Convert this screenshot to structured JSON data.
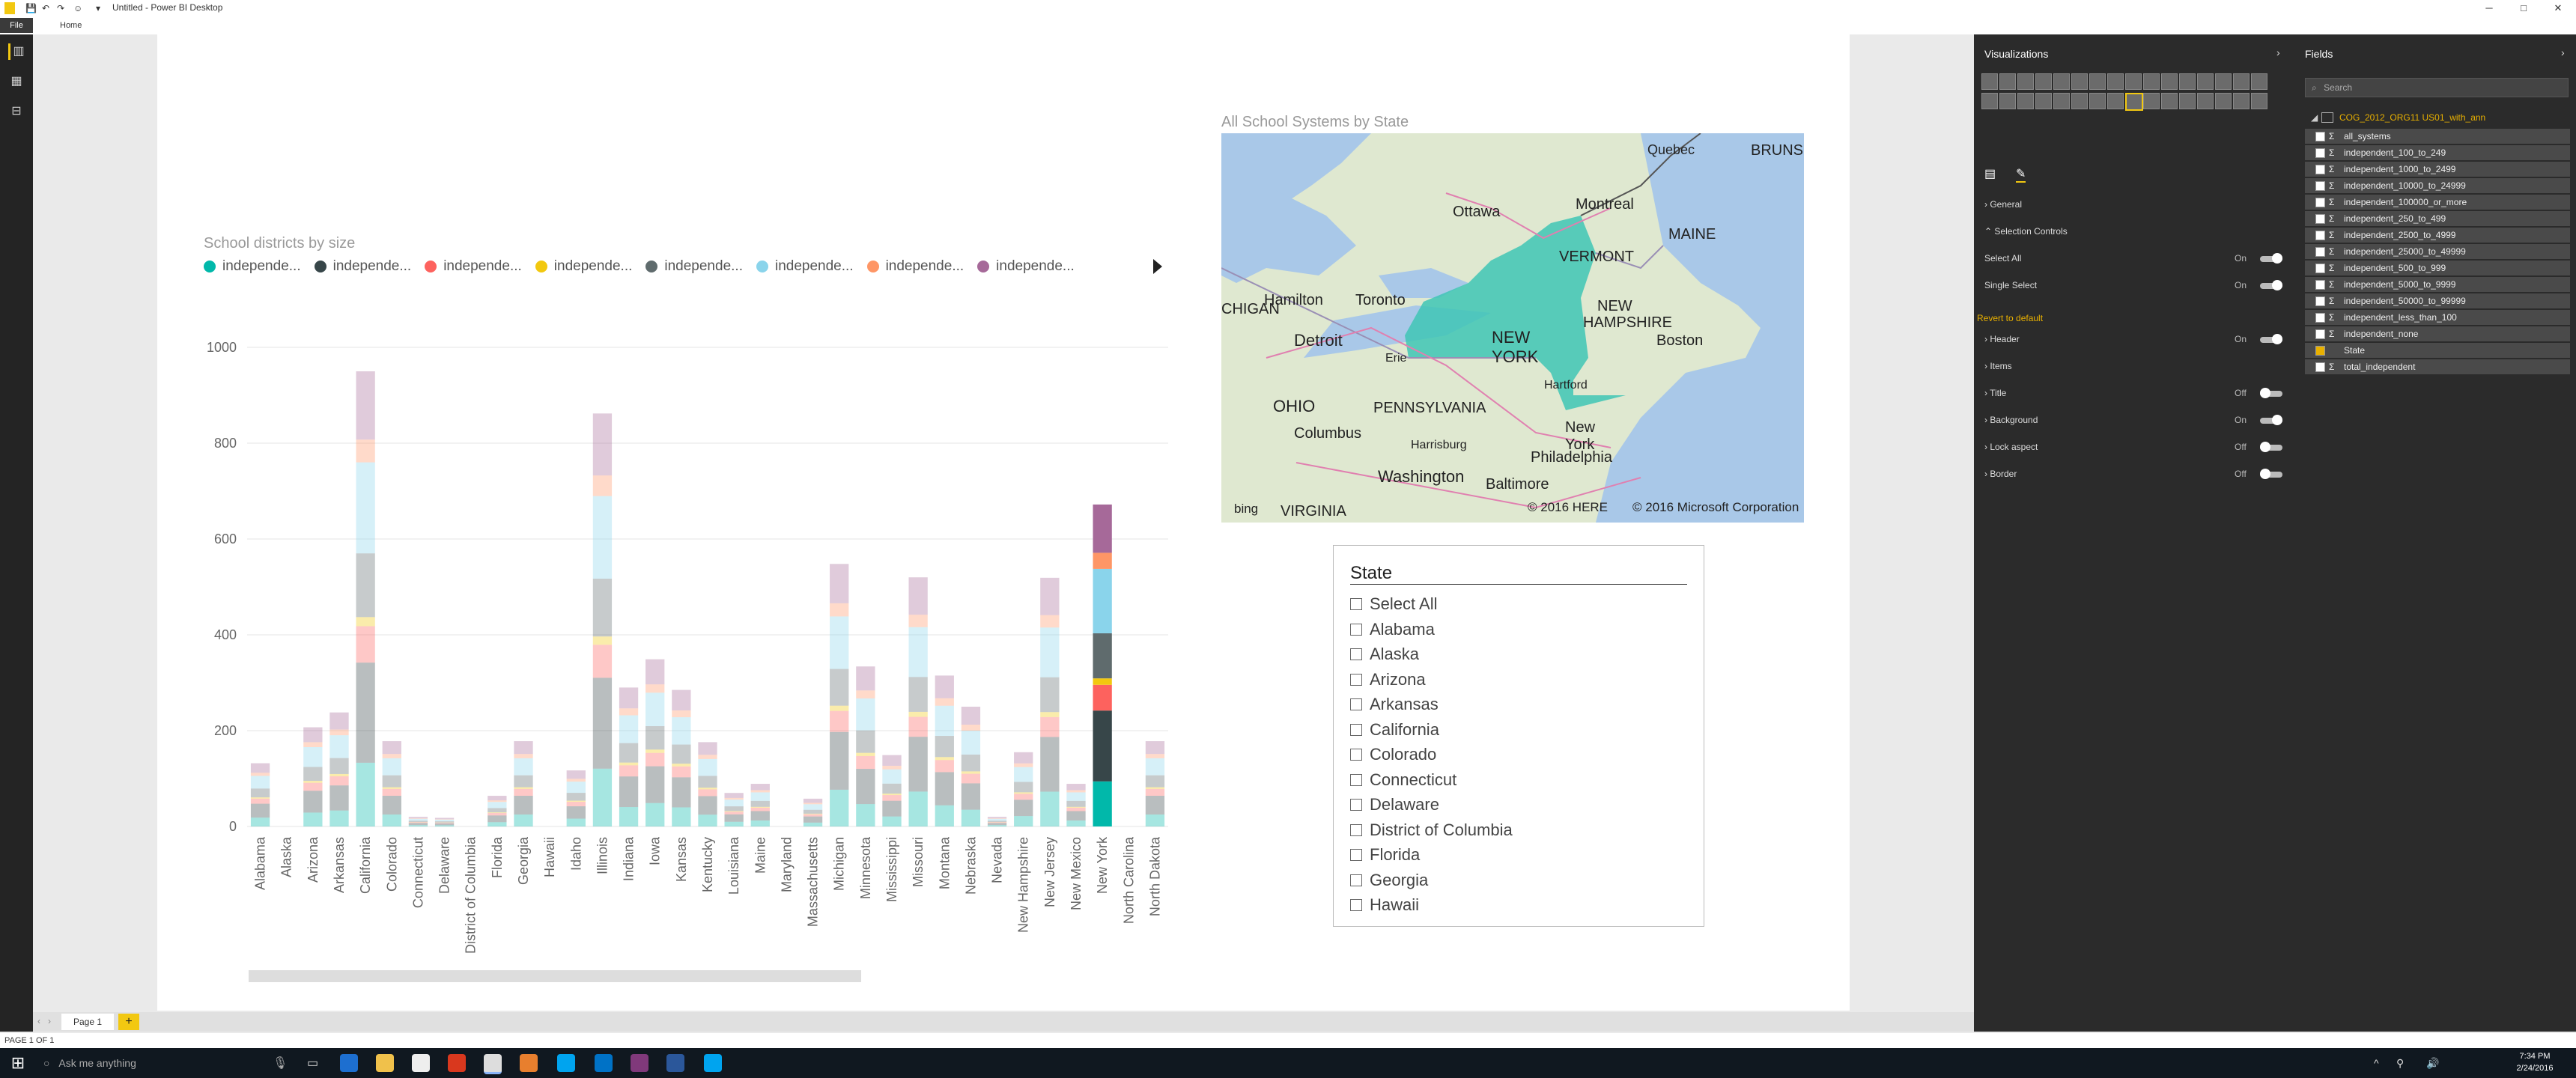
{
  "window": {
    "title": "Untitled - Power BI Desktop",
    "controls": {
      "minimize": "─",
      "maximize": "□",
      "close": "✕"
    }
  },
  "ribbon": {
    "file": "File",
    "home": "Home"
  },
  "bar_chart_visual": {
    "title": "School districts by size",
    "legend": [
      {
        "label": "independe...",
        "color": "#01b8aa"
      },
      {
        "label": "independe...",
        "color": "#374649"
      },
      {
        "label": "independe...",
        "color": "#fd625e"
      },
      {
        "label": "independe...",
        "color": "#f2c80f"
      },
      {
        "label": "independe...",
        "color": "#5f6b6d"
      },
      {
        "label": "independe...",
        "color": "#8ad4eb"
      },
      {
        "label": "independe...",
        "color": "#fe9666"
      },
      {
        "label": "independe...",
        "color": "#a66999"
      }
    ]
  },
  "chart_data": {
    "type": "bar",
    "stacked": true,
    "title": "School districts by size",
    "ylim": [
      0,
      1000
    ],
    "yticks": [
      0,
      200,
      400,
      600,
      800,
      1000
    ],
    "grid": true,
    "categories": [
      "Alabama",
      "Alaska",
      "Arizona",
      "Arkansas",
      "California",
      "Colorado",
      "Connecticut",
      "Delaware",
      "District of Columbia",
      "Florida",
      "Georgia",
      "Hawaii",
      "Idaho",
      "Illinois",
      "Indiana",
      "Iowa",
      "Kansas",
      "Kentucky",
      "Louisiana",
      "Maine",
      "Maryland",
      "Massachusetts",
      "Michigan",
      "Minnesota",
      "Mississippi",
      "Missouri",
      "Montana",
      "Nebraska",
      "Nevada",
      "New Hampshire",
      "New Jersey",
      "New Mexico",
      "New York",
      "North Carolina",
      "North Dakota"
    ],
    "totals": [
      132,
      0,
      207,
      238,
      950,
      178,
      20,
      18,
      0,
      64,
      178,
      0,
      117,
      862,
      290,
      349,
      285,
      176,
      70,
      89,
      0,
      58,
      548,
      334,
      149,
      520,
      315,
      250,
      20,
      155,
      519,
      89,
      672,
      0,
      178
    ],
    "series_colors": [
      "#01b8aa",
      "#374649",
      "#fd625e",
      "#f2c80f",
      "#5f6b6d",
      "#8ad4eb",
      "#fe9666",
      "#a66999"
    ]
  },
  "map_visual": {
    "title": "All School Systems by State",
    "labels": [
      "Quebec",
      "BRUNS",
      "Ottawa",
      "Montreal",
      "MAINE",
      "VERMONT",
      "CHIGAN",
      "Hamilton",
      "Toronto",
      "NEW",
      "HAMPSHIRE",
      "NEW YORK",
      "Boston",
      "Detroit",
      "Erie",
      "Hartford",
      "OHIO",
      "PENNSYLVANIA",
      "New York",
      "Columbus",
      "Harrisburg",
      "Philadelphia",
      "Washington",
      "Baltimore",
      "VIRGINIA"
    ],
    "copyright_here": "© 2016 HERE",
    "copyright_ms": "© 2016 Microsoft Corporation",
    "bing": "bing"
  },
  "slicer": {
    "title": "State",
    "items": [
      "Select All",
      "Alabama",
      "Alaska",
      "Arizona",
      "Arkansas",
      "California",
      "Colorado",
      "Connecticut",
      "Delaware",
      "District of Columbia",
      "Florida",
      "Georgia",
      "Hawaii"
    ]
  },
  "visualizations_pane": {
    "title": "Visualizations",
    "format_sections": [
      {
        "label": "General",
        "value": ""
      },
      {
        "label": "Selection Controls",
        "value": ""
      },
      {
        "label": "Select All",
        "value": "On"
      },
      {
        "label": "Single Select",
        "value": "On"
      },
      {
        "label": "Header",
        "value": "On"
      },
      {
        "label": "Items",
        "value": ""
      },
      {
        "label": "Title",
        "value": "Off"
      },
      {
        "label": "Background",
        "value": "On"
      },
      {
        "label": "Lock aspect",
        "value": "Off"
      },
      {
        "label": "Border",
        "value": "Off"
      }
    ],
    "revert": "Revert to default"
  },
  "fields_pane": {
    "title": "Fields",
    "search_placeholder": "Search",
    "table": "COG_2012_ORG11 US01_with_ann",
    "fields": [
      "all_systems",
      "independent_100_to_249",
      "independent_1000_to_2499",
      "independent_10000_to_24999",
      "independent_100000_or_more",
      "independent_250_to_499",
      "independent_2500_to_4999",
      "independent_25000_to_49999",
      "independent_500_to_999",
      "independent_5000_to_9999",
      "independent_50000_to_99999",
      "independent_less_than_100",
      "independent_none",
      "State",
      "total_independent"
    ]
  },
  "page_tabs": {
    "page1": "Page 1",
    "add": "+"
  },
  "status_bar": {
    "text": "PAGE 1 OF 1"
  },
  "taskbar": {
    "search_placeholder": "Ask me anything",
    "time": "7:34 PM",
    "date": "2/24/2016"
  }
}
